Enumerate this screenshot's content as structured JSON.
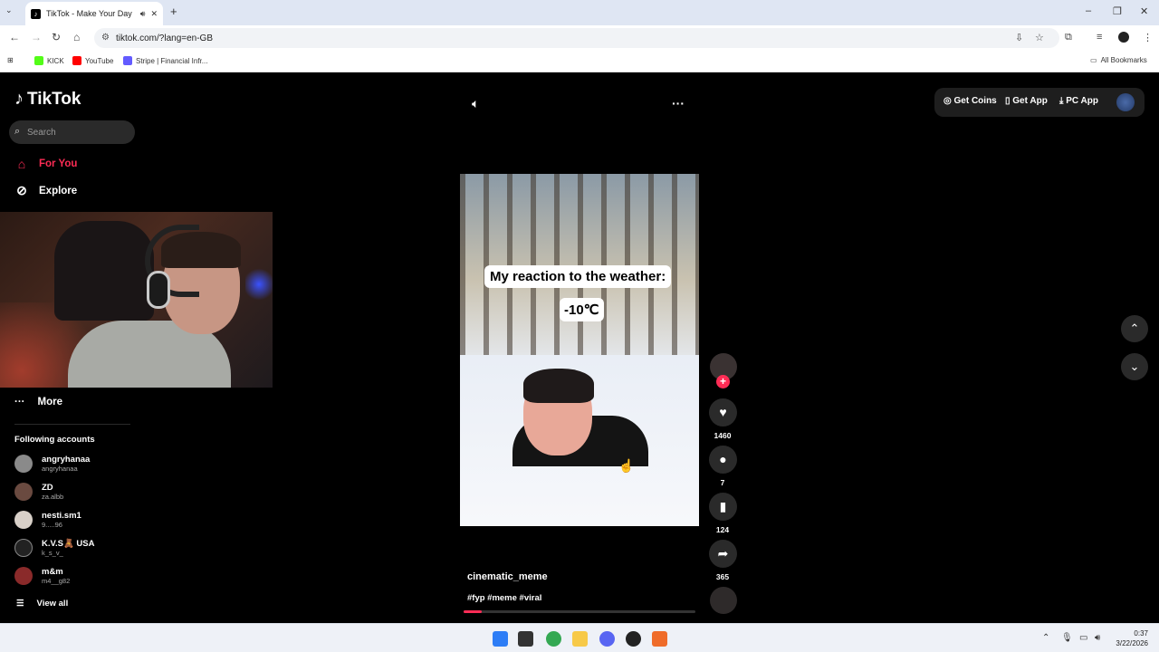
{
  "browser": {
    "tab_title": "TikTok - Make Your Day",
    "url": "tiktok.com/?lang=en-GB",
    "bookmarks": [
      "KICK",
      "YouTube",
      "Stripe | Financial Infr..."
    ],
    "all_bookmarks": "All Bookmarks"
  },
  "tiktok": {
    "logo": "TikTok",
    "search_placeholder": "Search",
    "nav": [
      {
        "label": "For You",
        "icon": "home-icon",
        "active": true
      },
      {
        "label": "Explore",
        "icon": "compass-icon",
        "active": false
      }
    ],
    "more_label": "More",
    "following_title": "Following accounts",
    "accounts": [
      {
        "name": "angryhanaa",
        "handle": "angryhanaa"
      },
      {
        "name": "ZD",
        "handle": "za.albb"
      },
      {
        "name": "nesti.sm1",
        "handle": "9.....96"
      },
      {
        "name": "K.V.S🧸 USA",
        "handle": "k_s_v_"
      },
      {
        "name": "m&m",
        "handle": "m4__g82"
      }
    ],
    "view_all": "View all",
    "header_actions": {
      "coins": "Get Coins",
      "app": "Get App",
      "pc": "PC App"
    },
    "video": {
      "caption_line1": "My reaction to the weather:",
      "caption_line2": "-10℃",
      "author": "cinematic_meme",
      "tags": "#fyp #meme #viral",
      "progress": 0.08
    },
    "counts": {
      "likes": "1460",
      "comments": "7",
      "saves": "124",
      "shares": "365"
    }
  },
  "taskbar": {
    "time": "0:37",
    "date": "3/22/2026"
  },
  "colors": {
    "accent": "#fe2c55"
  }
}
